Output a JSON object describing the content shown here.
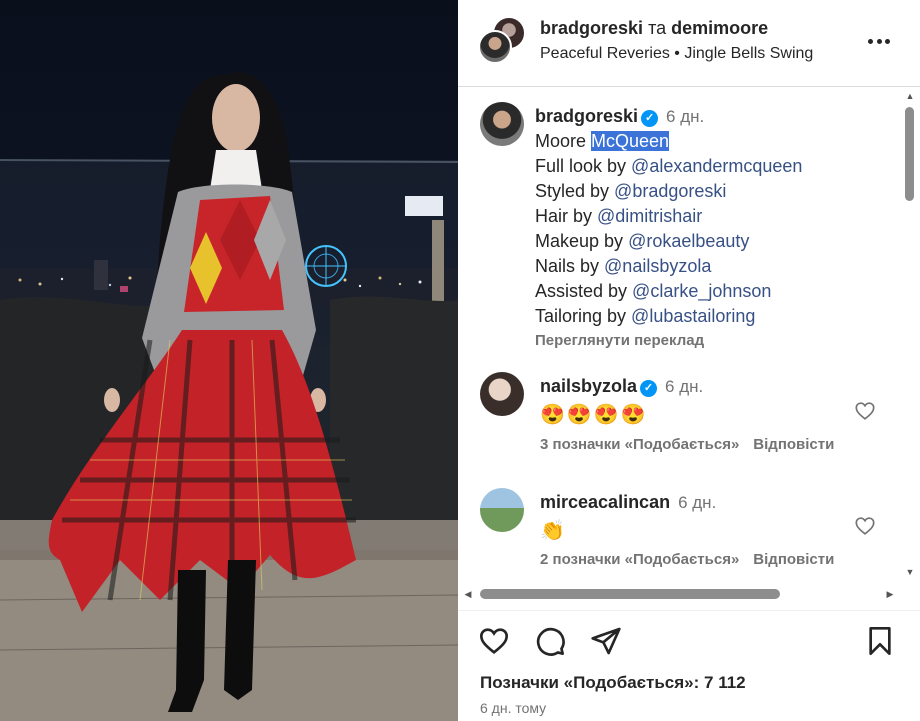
{
  "header": {
    "author_1": "bradgoreski",
    "conjunction": "та",
    "author_2": "demimoore",
    "music": "Peaceful Reveries • Jingle Bells Swing"
  },
  "caption": {
    "username": "bradgoreski",
    "time": "6 дн.",
    "line_1_plain": "Moore ",
    "line_1_highlight": "McQueen",
    "lines": [
      {
        "prefix": "Full look by ",
        "mention": "@alexandermcqueen"
      },
      {
        "prefix": "Styled by ",
        "mention": "@bradgoreski"
      },
      {
        "prefix": "Hair by ",
        "mention": "@dimitrishair"
      },
      {
        "prefix": "Makeup by ",
        "mention": "@rokaelbeauty"
      },
      {
        "prefix": "Nails by ",
        "mention": "@nailsbyzola"
      },
      {
        "prefix": "Assisted by ",
        "mention": "@clarke_johnson"
      },
      {
        "prefix": "Tailoring by ",
        "mention": "@lubastailoring"
      }
    ],
    "translate": "Переглянути переклад"
  },
  "comments": [
    {
      "username": "nailsbyzola",
      "verified": true,
      "time": "6 дн.",
      "text": "😍😍😍😍",
      "likes": "3 позначки «Подобається»",
      "reply": "Відповісти"
    },
    {
      "username": "mirceacalincan",
      "verified": false,
      "time": "6 дн.",
      "text": "👏",
      "likes": "2 позначки «Подобається»",
      "reply": "Відповісти"
    }
  ],
  "footer": {
    "likes_total": "Позначки «Подобається»: 7 112",
    "posted": "6 дн. тому"
  },
  "icons": [
    "more-horizontal-icon",
    "verified-badge-icon",
    "heart-icon",
    "comment-icon",
    "share-icon",
    "bookmark-icon"
  ],
  "colors": {
    "link": "#385185",
    "verified": "#0095f6",
    "highlight": "#3b73d9",
    "muted": "#737373"
  }
}
